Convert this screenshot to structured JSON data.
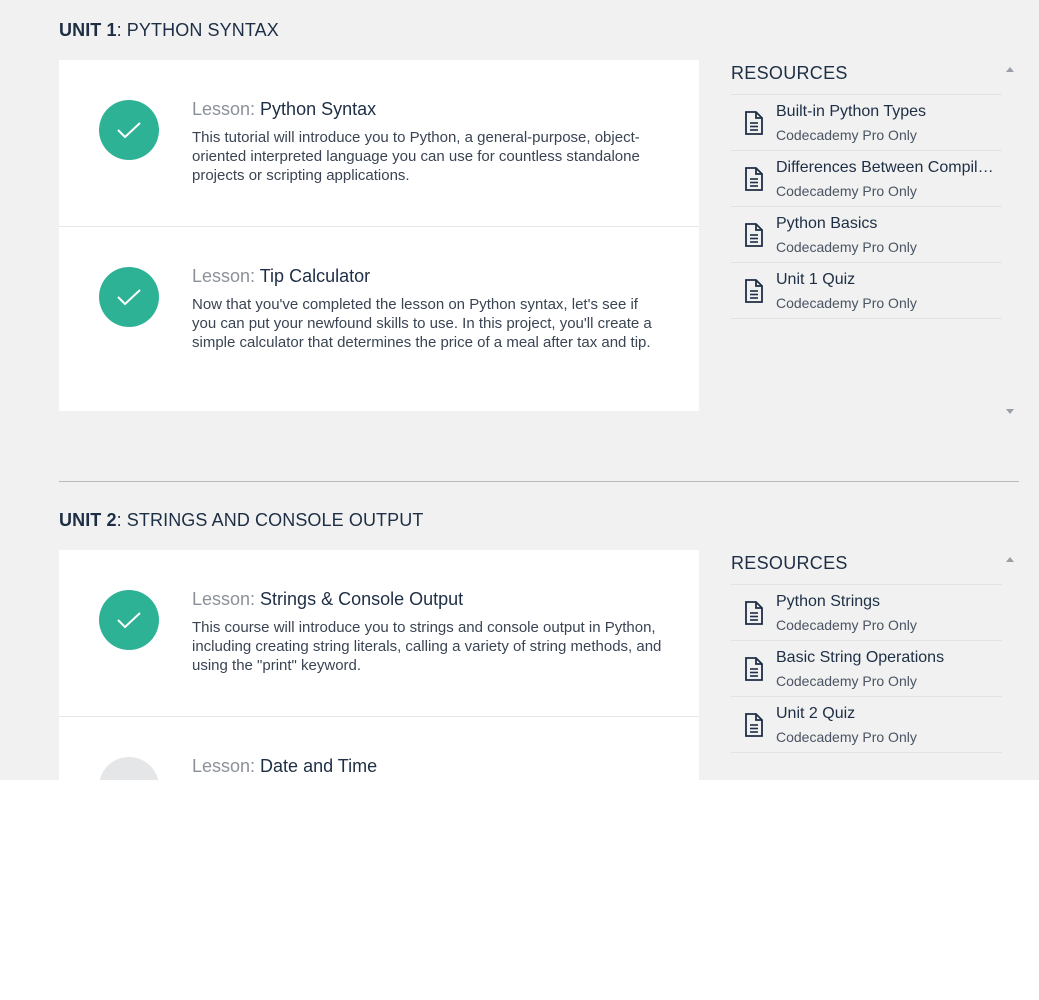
{
  "units": [
    {
      "label_bold": "UNIT 1",
      "label_rest": ": PYTHON SYNTAX",
      "lessons": [
        {
          "prefix": "Lesson: ",
          "title": "Python Syntax",
          "description": "This tutorial will introduce you to Python, a general-purpose, object-oriented interpreted language you can use for countless standalone projects or scripting applications.",
          "status": "completed"
        },
        {
          "prefix": "Lesson: ",
          "title": "Tip Calculator",
          "description": "Now that you've completed the lesson on Python syntax, let's see if you can put your newfound skills to use. In this project, you'll create a simple calculator that determines the price of a meal after tax and tip.",
          "status": "completed"
        }
      ],
      "resources": {
        "heading": "RESOURCES",
        "items": [
          {
            "name": "Built-in Python Types",
            "sub": "Codecademy Pro Only"
          },
          {
            "name": "Differences Between Compiled and Interpreted Languages",
            "sub": "Codecademy Pro Only"
          },
          {
            "name": "Python Basics",
            "sub": "Codecademy Pro Only"
          },
          {
            "name": "Unit 1 Quiz",
            "sub": "Codecademy Pro Only"
          }
        ]
      }
    },
    {
      "label_bold": "UNIT 2",
      "label_rest": ": STRINGS AND CONSOLE OUTPUT",
      "lessons": [
        {
          "prefix": "Lesson: ",
          "title": "Strings & Console Output",
          "description": "This course will introduce you to strings and console output in Python, including creating string literals, calling a variety of string methods, and using the \"print\" keyword.",
          "status": "completed"
        },
        {
          "prefix": "Lesson: ",
          "title": "Date and Time",
          "description": "",
          "status": "incomplete"
        }
      ],
      "resources": {
        "heading": "RESOURCES",
        "items": [
          {
            "name": "Python Strings",
            "sub": "Codecademy Pro Only"
          },
          {
            "name": "Basic String Operations",
            "sub": "Codecademy Pro Only"
          },
          {
            "name": "Unit 2 Quiz",
            "sub": "Codecademy Pro Only"
          }
        ]
      }
    }
  ],
  "colors": {
    "completed": "#2eb296",
    "incomplete": "#e4e6e8",
    "text": "#1e2e45"
  },
  "icons": {
    "completed": "checkmark-icon",
    "resource": "document-icon"
  }
}
